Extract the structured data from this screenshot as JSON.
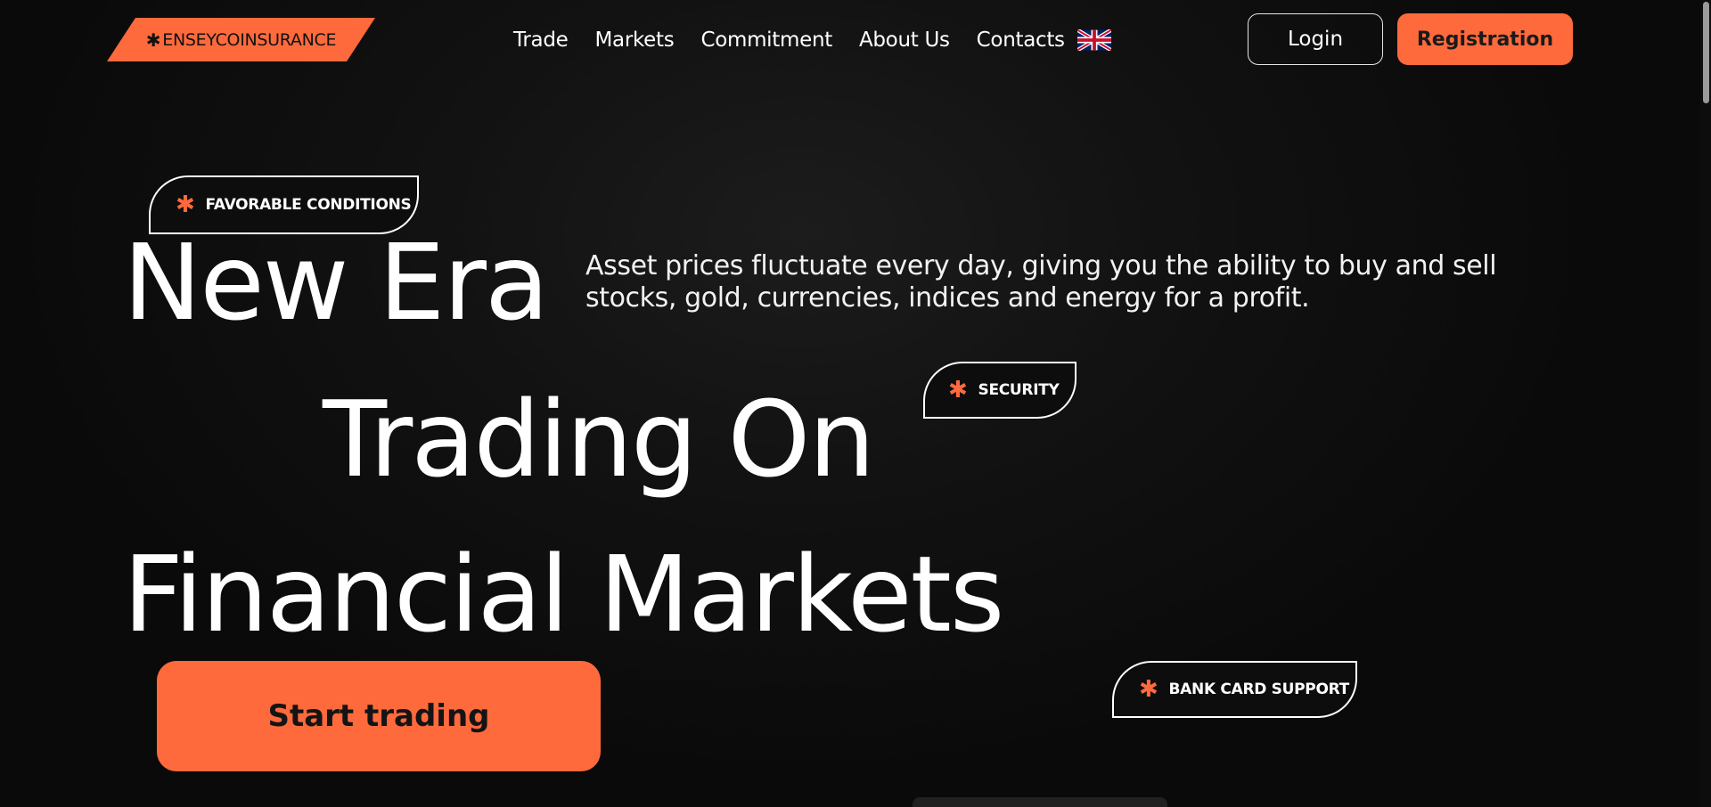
{
  "header": {
    "logo_text": "ENSEYCOINSURANCE",
    "logo_symbol": "✱",
    "nav": [
      {
        "label": "Trade"
      },
      {
        "label": "Markets"
      },
      {
        "label": "Commitment"
      },
      {
        "label": "About Us"
      },
      {
        "label": "Contacts"
      }
    ],
    "language_flag": "uk-flag-icon",
    "login_label": "Login",
    "register_label": "Registration"
  },
  "hero": {
    "tags": {
      "favorable": "FAVORABLE CONDITIONS",
      "security": "SECURITY",
      "bank_card": "BANK CARD SUPPORT"
    },
    "tag_symbol": "✱",
    "headline": {
      "line1": "New Era",
      "line2": "Trading On",
      "line3": "Financial Markets"
    },
    "lead": "Asset prices fluctuate every day, giving you the ability to buy and sell stocks, gold, currencies, indices and energy for a profit.",
    "cta_label": "Start trading"
  },
  "colors": {
    "accent": "#ff6a3d",
    "background": "#0b0b0b",
    "text": "#ffffff"
  }
}
